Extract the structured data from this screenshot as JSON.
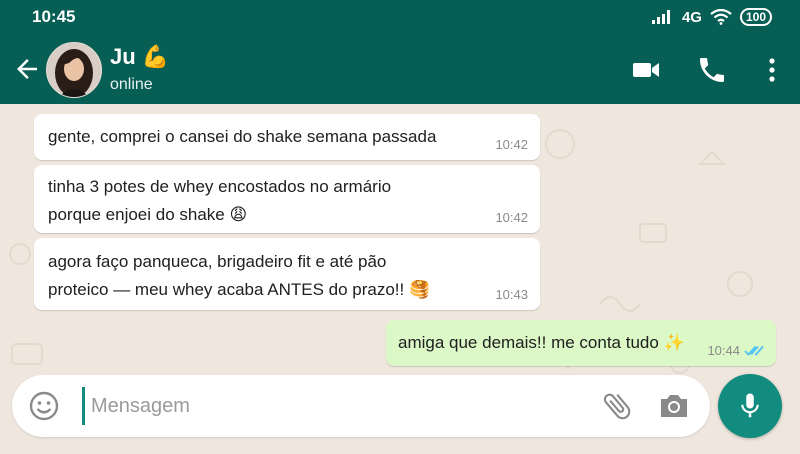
{
  "status_bar": {
    "time": "10:45",
    "network": "4G",
    "battery": "100"
  },
  "header": {
    "contact_name": "Ju 💪",
    "contact_status": "online",
    "icons": [
      "back-arrow-icon",
      "video-call-icon",
      "phone-icon",
      "more-vert-icon"
    ]
  },
  "messages": [
    {
      "direction": "in",
      "text": "gente, comprei o cansei do shake semana passada",
      "time": "10:42"
    },
    {
      "direction": "in",
      "text_line1": "tinha 3 potes de whey encostados no armário",
      "text_line2": "porque enjoei do shake 😩",
      "time": "10:42"
    },
    {
      "direction": "in",
      "text_line1": "agora faço panqueca, brigadeiro fit e até pão",
      "text_line2": "proteico — meu whey acaba ANTES do prazo!! 🥞",
      "time": "10:43"
    },
    {
      "direction": "out",
      "text": "amiga que demais!! me conta tudo ✨",
      "time": "10:44",
      "read": true
    }
  ],
  "composer": {
    "placeholder": "Mensagem",
    "value": ""
  },
  "colors": {
    "header": "#075e54",
    "accent": "#128c7e",
    "outgoing_bubble": "#dcf8c6",
    "read_ticks": "#4fc3f7"
  }
}
